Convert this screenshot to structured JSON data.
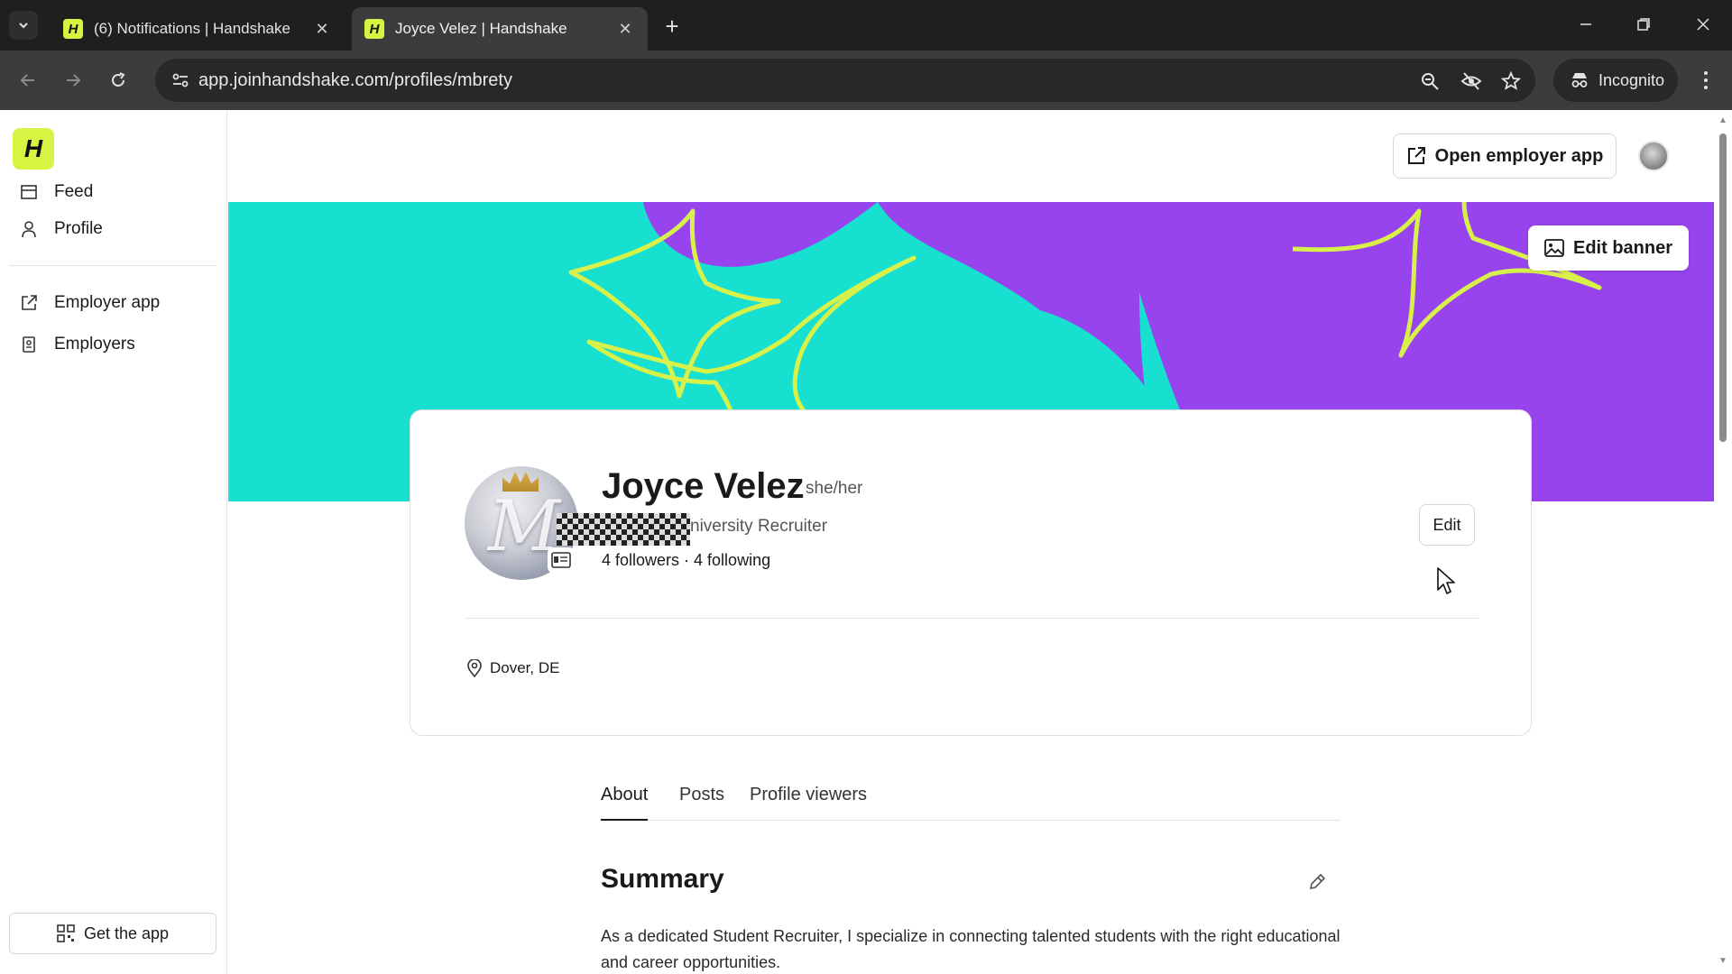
{
  "browser": {
    "tabs": [
      {
        "title": "(6) Notifications | Handshake",
        "favicon": "H",
        "active": false
      },
      {
        "title": "Joyce Velez | Handshake",
        "favicon": "H",
        "active": true
      }
    ],
    "url": "app.joinhandshake.com/profiles/mbrety",
    "incognito_label": "Incognito"
  },
  "sidebar": {
    "logo": "H",
    "items": [
      {
        "label": "Feed",
        "icon": "feed-icon"
      },
      {
        "label": "Profile",
        "icon": "person-icon"
      },
      {
        "label": "Employer app",
        "icon": "external-link-icon"
      },
      {
        "label": "Employers",
        "icon": "badge-icon"
      }
    ],
    "get_app": "Get the app"
  },
  "header": {
    "open_employer_app": "Open employer app"
  },
  "banner": {
    "edit_label": "Edit banner",
    "colors": {
      "teal": "#18e0d0",
      "purple": "#9744ee",
      "lime": "#d8f04a"
    }
  },
  "profile": {
    "name": "Joyce Velez",
    "pronouns": "she/her",
    "headline_visible": "niversity Recruiter",
    "followers_line": "4 followers · 4 following",
    "edit_label": "Edit",
    "location": "Dover, DE"
  },
  "tabs": [
    {
      "label": "About",
      "active": true
    },
    {
      "label": "Posts",
      "active": false
    },
    {
      "label": "Profile viewers",
      "active": false
    }
  ],
  "summary": {
    "title": "Summary",
    "text": "As a dedicated Student Recruiter, I specialize in connecting talented students with the right educational and career opportunities."
  }
}
